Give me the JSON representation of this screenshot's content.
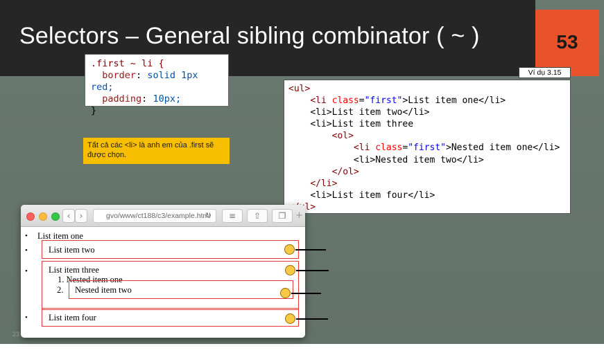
{
  "slide": {
    "title": "Selectors – General sibling combinator ( ~ )",
    "page_number": "53",
    "example_label": "Ví dụ 3.15",
    "note": "Tất cả các <li> là anh em của .first sẽ được chọn.",
    "slide_footer_number": "23"
  },
  "css_code": {
    "selector": ".first ~ li {",
    "line1_prop": "border",
    "line1_value": "solid 1px red;",
    "line2_prop": "padding",
    "line2_value": "10px;",
    "close": "}"
  },
  "html_code": {
    "ul_open": "<ul>",
    "li1_open": "<li ",
    "li1_attr": "class",
    "li1_val": "\"first\"",
    "li1_text": ">List item one</li>",
    "li2": "<li>List item two</li>",
    "li3": "<li>List item three",
    "ol_open": "<ol>",
    "nli1_open": "<li ",
    "nli1_attr": "class",
    "nli1_val": "\"first\"",
    "nli1_text": ">Nested item one</li>",
    "nli2": "<li>Nested item two</li>",
    "ol_close": "</ol>",
    "li_close": "</li>",
    "li4": "<li>List item four</li>",
    "ul_close": "</ul>"
  },
  "browser": {
    "address": "gvo/www/ct188/c3/example.html",
    "items": {
      "one": "List item one",
      "two": "List item two",
      "three": "List item three",
      "nested_one": "Nested item one",
      "nested_two": "Nested item two",
      "four": "List item four"
    },
    "nested_markers": [
      "1.",
      "2."
    ]
  },
  "colors": {
    "title_bar": "#262626",
    "page_badge": "#e8532b",
    "note_bg": "#f8bf00",
    "highlight_border": "#e53935"
  }
}
